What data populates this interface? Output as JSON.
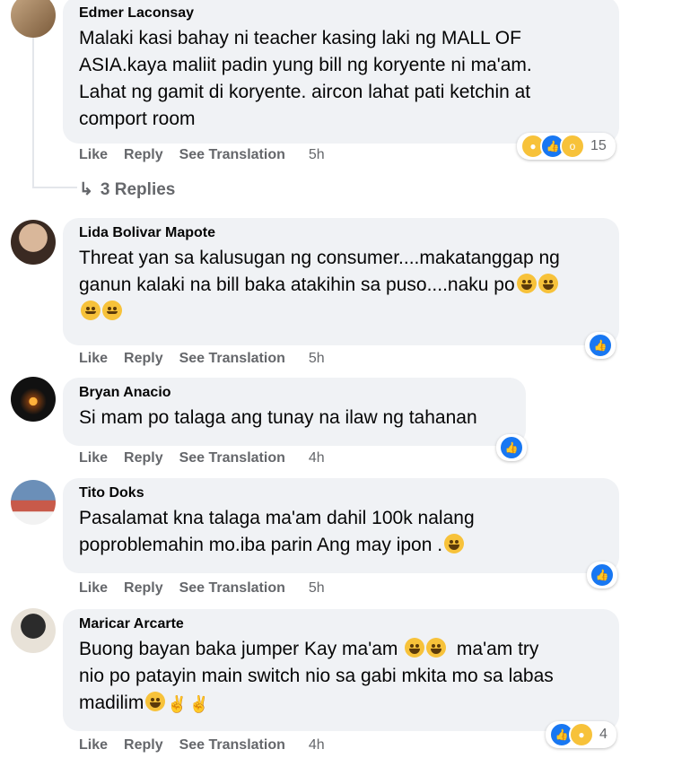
{
  "comments": [
    {
      "author": "Edmer Laconsay",
      "lines": [
        "Malaki kasi bahay ni teacher kasing laki ng MALL OF",
        "ASIA.kaya maliit padin yung bill ng koryente ni ma'am.",
        "Lahat ng gamit di koryente. aircon lahat pati ketchin at",
        "comport room"
      ],
      "time": "5h",
      "reactions_count": "15"
    },
    {
      "author": "Lida Bolivar Mapote",
      "lines": [
        "Threat yan sa kalusugan ng consumer....makatanggap ng",
        "ganun kalaki na bill baka atakihin sa puso....naku po"
      ],
      "time": "5h"
    },
    {
      "author": "Bryan Anacio",
      "lines": [
        "Si mam po talaga ang tunay na ilaw ng tahanan"
      ],
      "time": "4h"
    },
    {
      "author": "Tito Doks",
      "lines": [
        "Pasalamat kna talaga ma'am dahil 100k nalang",
        "poproblemahin mo.iba parin Ang may ipon ."
      ],
      "time": "5h"
    },
    {
      "author": "Maricar Arcarte",
      "lines": [
        "Buong bayan baka jumper Kay ma'am",
        "ma'am try",
        "nio po patayin main switch nio sa gabi mkita mo sa labas",
        "madilim"
      ],
      "time": "4h",
      "reactions_count": "4"
    }
  ],
  "actions": {
    "like": "Like",
    "reply": "Reply",
    "see_translation": "See Translation"
  },
  "replies_label": "3 Replies",
  "colors": {
    "bubble": "#f0f2f5",
    "action_text": "#65676b",
    "like_blue": "#1877f2"
  },
  "icons": [
    "haha-emoji-icon",
    "like-reaction-icon",
    "wow-reaction-icon",
    "reply-arrow-icon",
    "victory-hand-icon"
  ]
}
